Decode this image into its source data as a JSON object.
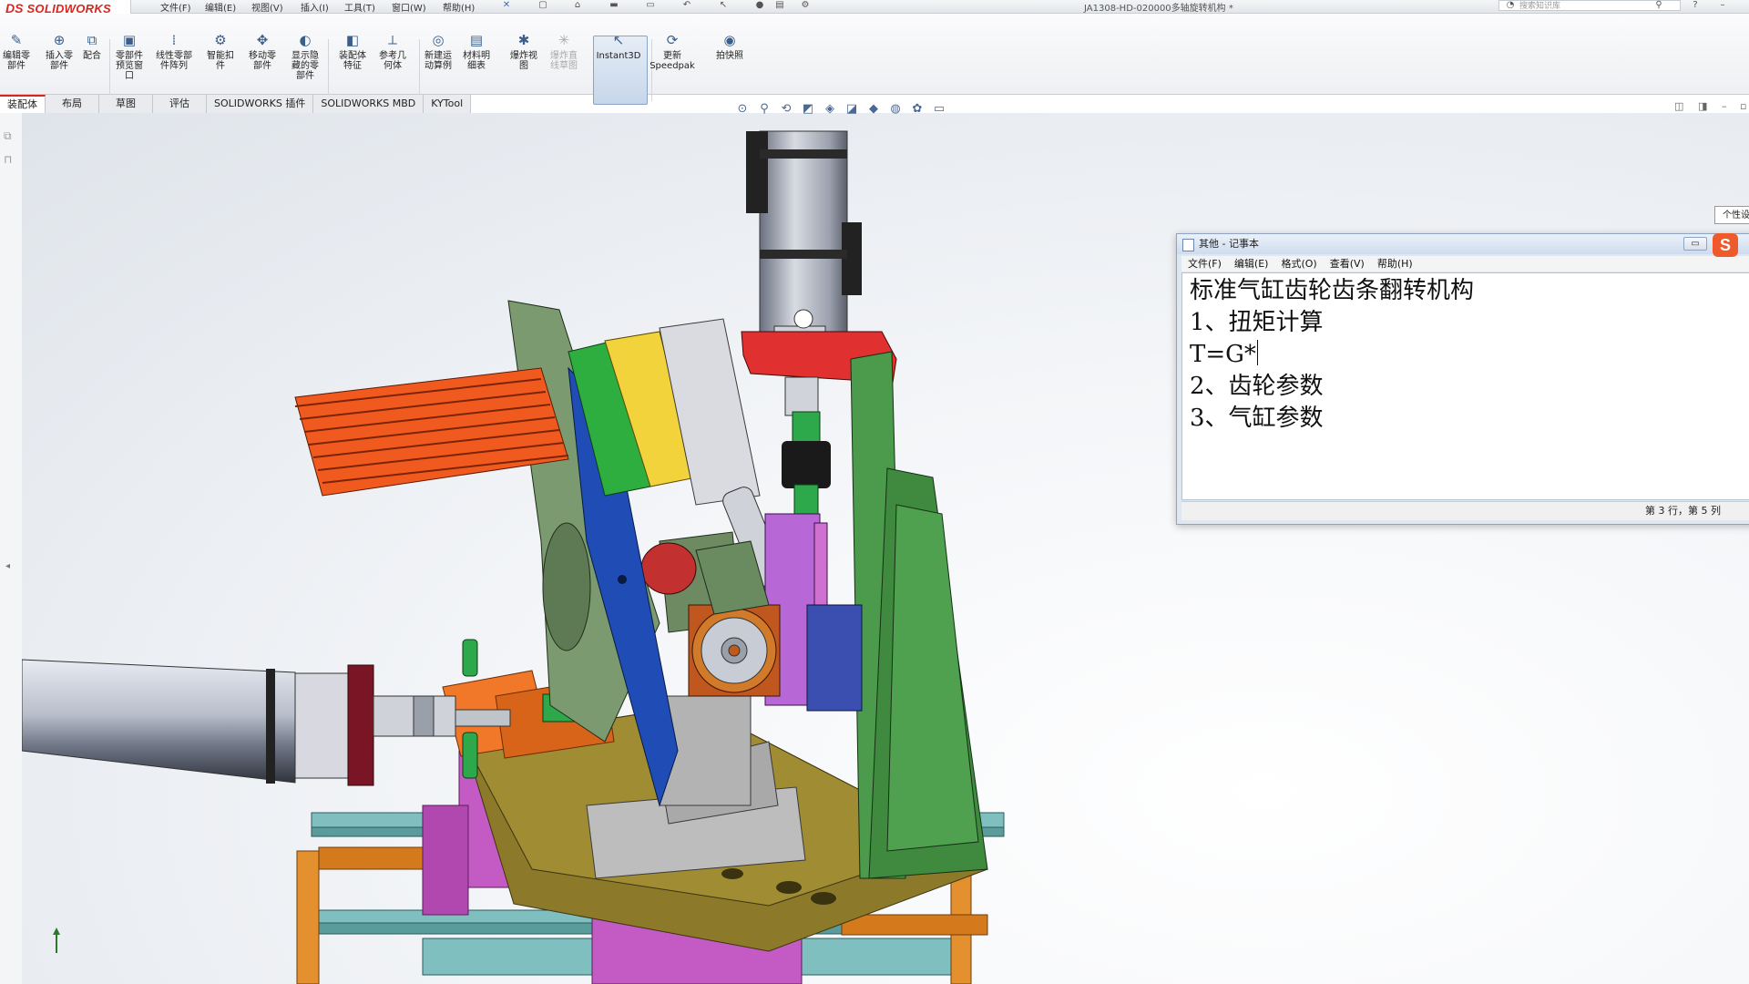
{
  "app": {
    "logo_ds": "DS",
    "logo_name": "SOLIDWORKS"
  },
  "menu": [
    "文件(F)",
    "编辑(E)",
    "视图(V)",
    "插入(I)",
    "工具(T)",
    "窗口(W)",
    "帮助(H)"
  ],
  "document_title": "JA1308-HD-020000多轴旋转机构 *",
  "search_placeholder": "搜索知识库",
  "ribbon": {
    "buttons": [
      {
        "label": "编辑零\n部件",
        "icon": "edit-component-icon",
        "glyph": "✎"
      },
      {
        "label": "插入零\n部件",
        "icon": "insert-component-icon",
        "glyph": "⊕"
      },
      {
        "label": "配合",
        "icon": "mate-icon",
        "glyph": "⧉"
      },
      {
        "label": "零部件\n预览窗\n口",
        "icon": "preview-window-icon",
        "glyph": "▣"
      },
      {
        "label": "线性零部\n件阵列",
        "icon": "linear-pattern-icon",
        "glyph": "⁞"
      },
      {
        "label": "智能扣\n件",
        "icon": "smart-fastener-icon",
        "glyph": "⚙"
      },
      {
        "label": "移动零\n部件",
        "icon": "move-component-icon",
        "glyph": "✥"
      },
      {
        "label": "显示隐\n藏的零\n部件",
        "icon": "show-hidden-icon",
        "glyph": "◐"
      },
      {
        "label": "装配体\n特征",
        "icon": "assembly-feature-icon",
        "glyph": "◧"
      },
      {
        "label": "参考几\n何体",
        "icon": "reference-geometry-icon",
        "glyph": "⟂"
      },
      {
        "label": "新建运\n动算例",
        "icon": "motion-study-icon",
        "glyph": "◎"
      },
      {
        "label": "材料明\n细表",
        "icon": "bom-icon",
        "glyph": "▤"
      },
      {
        "label": "爆炸视\n图",
        "icon": "exploded-view-icon",
        "glyph": "✱"
      },
      {
        "label": "爆炸直\n线草图",
        "icon": "explode-line-sketch-icon",
        "glyph": "✳"
      },
      {
        "label": "Instant3D",
        "icon": "instant3d-icon",
        "glyph": "↖"
      },
      {
        "label": "更新\nSpeedpak",
        "icon": "speedpak-icon",
        "glyph": "⟳"
      },
      {
        "label": "拍快照",
        "icon": "snapshot-icon",
        "glyph": "◉"
      }
    ]
  },
  "tabs": [
    "装配体",
    "布局",
    "草图",
    "评估",
    "SOLIDWORKS 插件",
    "SOLIDWORKS MBD",
    "KYTool"
  ],
  "notepad": {
    "title": "其他 - 记事本",
    "menu": [
      "文件(F)",
      "编辑(E)",
      "格式(O)",
      "查看(V)",
      "帮助(H)"
    ],
    "lines": [
      "标准气缸齿轮齿条翻转机构",
      "1、扭矩计算",
      "T=G*",
      "2、齿轮参数",
      "3、气缸参数"
    ],
    "status": "第 3 行，第 5 列"
  },
  "tooltip": "个性设",
  "sogou_letter": "S",
  "colors": {
    "brand_red": "#d7261e",
    "accent_blue": "#3b5e8a",
    "viewport_bg": "#eef1f5"
  }
}
